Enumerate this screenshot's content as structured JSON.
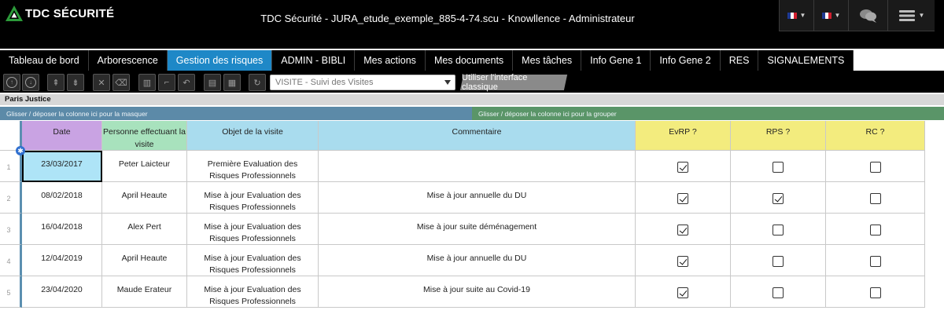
{
  "header": {
    "logo_text": "TDC SÉCURITÉ",
    "title": "TDC Sécurité - JURA_etude_exemple_885-4-74.scu - Knowllence - Administrateur"
  },
  "nav": {
    "tabs": [
      {
        "label": "Tableau de bord",
        "active": false
      },
      {
        "label": "Arborescence",
        "active": false
      },
      {
        "label": "Gestion des risques",
        "active": true
      },
      {
        "label": "ADMIN - BIBLI",
        "active": false
      },
      {
        "label": "Mes actions",
        "active": false
      },
      {
        "label": "Mes documents",
        "active": false
      },
      {
        "label": "Mes tâches",
        "active": false
      },
      {
        "label": "Info Gene 1",
        "active": false
      },
      {
        "label": "Info Gene 2",
        "active": false
      },
      {
        "label": "RES",
        "active": false
      },
      {
        "label": "SIGNALEMENTS",
        "active": false
      }
    ]
  },
  "toolbar": {
    "view_select": "VISITE - Suivi des Visites",
    "classic_button": "Utiliser l'interface classique"
  },
  "section": {
    "title": "Paris Justice",
    "hide_zone": "Glisser / déposer la colonne ici pour la masquer",
    "group_zone": "Glisser / déposer la colonne ici pour la grouper"
  },
  "table": {
    "columns": {
      "date": "Date",
      "person": "Personne effectuant la visite",
      "object": "Objet de la visite",
      "comment": "Commentaire",
      "evrp": "EvRP ?",
      "rps": "RPS ?",
      "rc": "RC ?"
    },
    "column_colors": {
      "date": "#c9a3e3",
      "person": "#a8e2bd",
      "object": "#a9dcee",
      "comment": "#a9dcee",
      "evrp": "#f3ec7e",
      "rps": "#f3ec7e",
      "rc": "#f3ec7e"
    },
    "rows": [
      {
        "num": "1",
        "date": "23/03/2017",
        "person": "Peter Laicteur",
        "object": "Première Evaluation des Risques Professionnels",
        "comment": "",
        "evrp": true,
        "rps": false,
        "rc": false
      },
      {
        "num": "2",
        "date": "08/02/2018",
        "person": "April Heaute",
        "object": "Mise à jour Evaluation des Risques Professionnels",
        "comment": "Mise à jour annuelle du DU",
        "evrp": true,
        "rps": true,
        "rc": false
      },
      {
        "num": "3",
        "date": "16/04/2018",
        "person": "Alex Pert",
        "object": "Mise à jour Evaluation des Risques Professionnels",
        "comment": "Mise à jour suite déménagement",
        "evrp": true,
        "rps": false,
        "rc": false
      },
      {
        "num": "4",
        "date": "12/04/2019",
        "person": "April Heaute",
        "object": "Mise à jour Evaluation des Risques Professionnels",
        "comment": "Mise à jour annuelle du DU",
        "evrp": true,
        "rps": false,
        "rc": false
      },
      {
        "num": "5",
        "date": "23/04/2020",
        "person": "Maude Erateur",
        "object": "Mise à jour Evaluation des Risques Professionnels",
        "comment": "Mise à jour suite au Covid-19",
        "evrp": true,
        "rps": false,
        "rc": false
      }
    ]
  }
}
